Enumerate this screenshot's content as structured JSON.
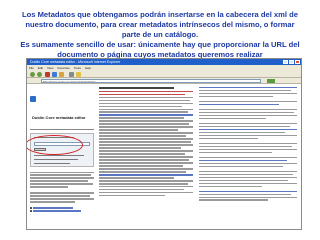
{
  "caption": {
    "line1": "Los Metadatos que obtengamos podrán insertarse en la cabecera del xml de",
    "line2": "nuestro documento, para crear metadatos intrínsecos del mismo, o formar",
    "line3": "parte de un catálogo.",
    "line4": "Es sumamente sencillo de usar: únicamente hay que proporcionar la URL del",
    "line5": "documento o página cuyos metadatos queremos realizar"
  },
  "browser": {
    "window_title": "Dublin Core metadata editor - Microsoft Internet Explorer",
    "menu": [
      "File",
      "Edit",
      "View",
      "Favorites",
      "Tools",
      "Help"
    ],
    "address": "http://www.ukoln.ac.uk/metadata/dcdot/",
    "site_title": "Dublin Core metadata editor"
  },
  "colors": {
    "caption_text": "#1d3aa3",
    "title_bar": "#1f5fc9",
    "highlight_oval": "#d42020"
  }
}
